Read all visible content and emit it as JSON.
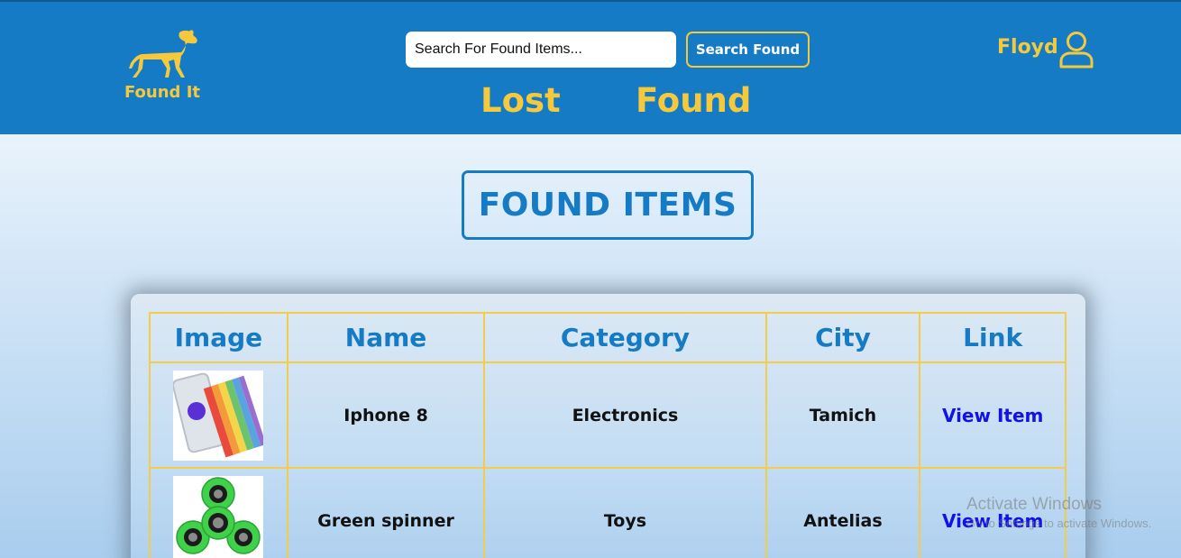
{
  "header": {
    "logo_text": "Found It",
    "search": {
      "placeholder": "Search For Found Items...",
      "button_label": "Search Found"
    },
    "nav": {
      "lost": "Lost",
      "found": "Found"
    },
    "user": {
      "name": "Floyd"
    },
    "colors": {
      "background": "#157bc5",
      "accent": "#f6c93c"
    }
  },
  "main": {
    "title": "FOUND ITEMS",
    "table": {
      "columns": [
        "Image",
        "Name",
        "Category",
        "City",
        "Link"
      ],
      "rows": [
        {
          "image": "iphone-photo",
          "name": "Iphone 8",
          "category": "Electronics",
          "city": "Tamich",
          "link": "View Item"
        },
        {
          "image": "spinner-photo",
          "name": "Green spinner",
          "category": "Toys",
          "city": "Antelias",
          "link": "View Item"
        }
      ]
    }
  },
  "os_watermark": {
    "title": "Activate Windows",
    "subtitle": "Go to Settings to activate Windows."
  }
}
